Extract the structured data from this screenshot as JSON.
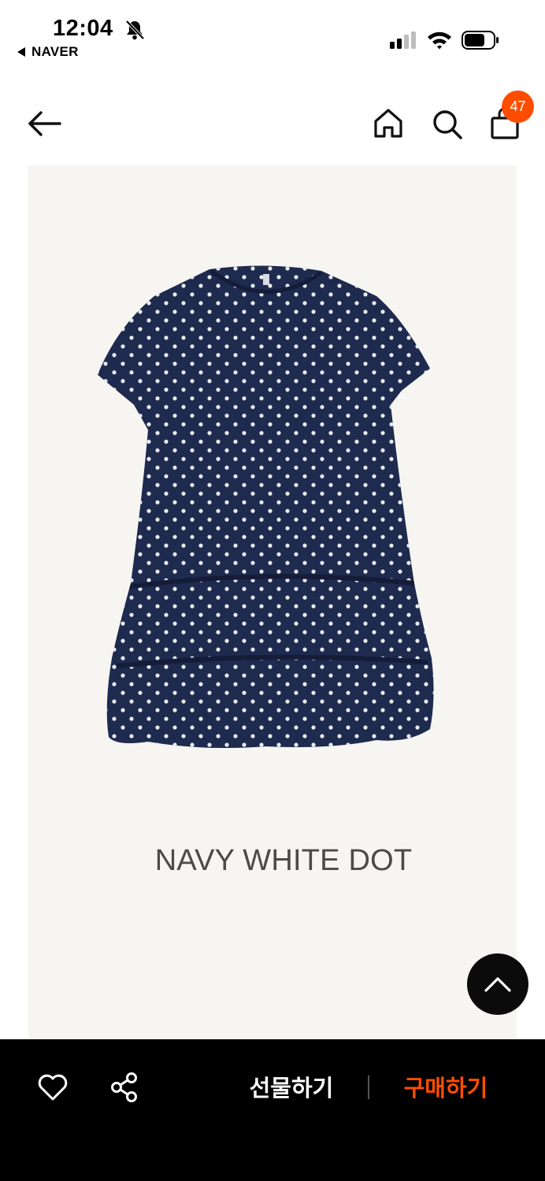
{
  "status_bar": {
    "time": "12:04",
    "back_app_label": "NAVER",
    "icons": [
      "bell-slash-icon",
      "cellular-signal-icon",
      "wifi-icon",
      "battery-icon"
    ]
  },
  "header": {
    "icons": [
      "arrow-left-icon",
      "home-icon",
      "search-icon",
      "shopping-bag-icon"
    ],
    "cart_count": "47"
  },
  "product": {
    "color_caption": "NAVY WHITE DOT",
    "colors": {
      "dress": "#1e2a4e",
      "dots": "#e9ecf2",
      "background": "#f6f5f1"
    }
  },
  "bottom_bar": {
    "gift_label": "선물하기",
    "buy_label": "구매하기",
    "icons": [
      "heart-icon",
      "share-icon"
    ],
    "accent_color": "#ff4d00"
  }
}
